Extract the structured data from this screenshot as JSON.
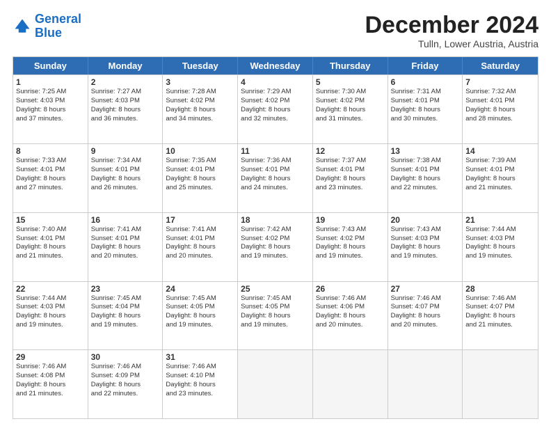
{
  "logo": {
    "line1": "General",
    "line2": "Blue"
  },
  "title": "December 2024",
  "subtitle": "Tulln, Lower Austria, Austria",
  "days_of_week": [
    "Sunday",
    "Monday",
    "Tuesday",
    "Wednesday",
    "Thursday",
    "Friday",
    "Saturday"
  ],
  "weeks": [
    [
      {
        "day": "1",
        "lines": [
          "Sunrise: 7:25 AM",
          "Sunset: 4:03 PM",
          "Daylight: 8 hours",
          "and 37 minutes."
        ]
      },
      {
        "day": "2",
        "lines": [
          "Sunrise: 7:27 AM",
          "Sunset: 4:03 PM",
          "Daylight: 8 hours",
          "and 36 minutes."
        ]
      },
      {
        "day": "3",
        "lines": [
          "Sunrise: 7:28 AM",
          "Sunset: 4:02 PM",
          "Daylight: 8 hours",
          "and 34 minutes."
        ]
      },
      {
        "day": "4",
        "lines": [
          "Sunrise: 7:29 AM",
          "Sunset: 4:02 PM",
          "Daylight: 8 hours",
          "and 32 minutes."
        ]
      },
      {
        "day": "5",
        "lines": [
          "Sunrise: 7:30 AM",
          "Sunset: 4:02 PM",
          "Daylight: 8 hours",
          "and 31 minutes."
        ]
      },
      {
        "day": "6",
        "lines": [
          "Sunrise: 7:31 AM",
          "Sunset: 4:01 PM",
          "Daylight: 8 hours",
          "and 30 minutes."
        ]
      },
      {
        "day": "7",
        "lines": [
          "Sunrise: 7:32 AM",
          "Sunset: 4:01 PM",
          "Daylight: 8 hours",
          "and 28 minutes."
        ]
      }
    ],
    [
      {
        "day": "8",
        "lines": [
          "Sunrise: 7:33 AM",
          "Sunset: 4:01 PM",
          "Daylight: 8 hours",
          "and 27 minutes."
        ]
      },
      {
        "day": "9",
        "lines": [
          "Sunrise: 7:34 AM",
          "Sunset: 4:01 PM",
          "Daylight: 8 hours",
          "and 26 minutes."
        ]
      },
      {
        "day": "10",
        "lines": [
          "Sunrise: 7:35 AM",
          "Sunset: 4:01 PM",
          "Daylight: 8 hours",
          "and 25 minutes."
        ]
      },
      {
        "day": "11",
        "lines": [
          "Sunrise: 7:36 AM",
          "Sunset: 4:01 PM",
          "Daylight: 8 hours",
          "and 24 minutes."
        ]
      },
      {
        "day": "12",
        "lines": [
          "Sunrise: 7:37 AM",
          "Sunset: 4:01 PM",
          "Daylight: 8 hours",
          "and 23 minutes."
        ]
      },
      {
        "day": "13",
        "lines": [
          "Sunrise: 7:38 AM",
          "Sunset: 4:01 PM",
          "Daylight: 8 hours",
          "and 22 minutes."
        ]
      },
      {
        "day": "14",
        "lines": [
          "Sunrise: 7:39 AM",
          "Sunset: 4:01 PM",
          "Daylight: 8 hours",
          "and 21 minutes."
        ]
      }
    ],
    [
      {
        "day": "15",
        "lines": [
          "Sunrise: 7:40 AM",
          "Sunset: 4:01 PM",
          "Daylight: 8 hours",
          "and 21 minutes."
        ]
      },
      {
        "day": "16",
        "lines": [
          "Sunrise: 7:41 AM",
          "Sunset: 4:01 PM",
          "Daylight: 8 hours",
          "and 20 minutes."
        ]
      },
      {
        "day": "17",
        "lines": [
          "Sunrise: 7:41 AM",
          "Sunset: 4:01 PM",
          "Daylight: 8 hours",
          "and 20 minutes."
        ]
      },
      {
        "day": "18",
        "lines": [
          "Sunrise: 7:42 AM",
          "Sunset: 4:02 PM",
          "Daylight: 8 hours",
          "and 19 minutes."
        ]
      },
      {
        "day": "19",
        "lines": [
          "Sunrise: 7:43 AM",
          "Sunset: 4:02 PM",
          "Daylight: 8 hours",
          "and 19 minutes."
        ]
      },
      {
        "day": "20",
        "lines": [
          "Sunrise: 7:43 AM",
          "Sunset: 4:03 PM",
          "Daylight: 8 hours",
          "and 19 minutes."
        ]
      },
      {
        "day": "21",
        "lines": [
          "Sunrise: 7:44 AM",
          "Sunset: 4:03 PM",
          "Daylight: 8 hours",
          "and 19 minutes."
        ]
      }
    ],
    [
      {
        "day": "22",
        "lines": [
          "Sunrise: 7:44 AM",
          "Sunset: 4:03 PM",
          "Daylight: 8 hours",
          "and 19 minutes."
        ]
      },
      {
        "day": "23",
        "lines": [
          "Sunrise: 7:45 AM",
          "Sunset: 4:04 PM",
          "Daylight: 8 hours",
          "and 19 minutes."
        ]
      },
      {
        "day": "24",
        "lines": [
          "Sunrise: 7:45 AM",
          "Sunset: 4:05 PM",
          "Daylight: 8 hours",
          "and 19 minutes."
        ]
      },
      {
        "day": "25",
        "lines": [
          "Sunrise: 7:45 AM",
          "Sunset: 4:05 PM",
          "Daylight: 8 hours",
          "and 19 minutes."
        ]
      },
      {
        "day": "26",
        "lines": [
          "Sunrise: 7:46 AM",
          "Sunset: 4:06 PM",
          "Daylight: 8 hours",
          "and 20 minutes."
        ]
      },
      {
        "day": "27",
        "lines": [
          "Sunrise: 7:46 AM",
          "Sunset: 4:07 PM",
          "Daylight: 8 hours",
          "and 20 minutes."
        ]
      },
      {
        "day": "28",
        "lines": [
          "Sunrise: 7:46 AM",
          "Sunset: 4:07 PM",
          "Daylight: 8 hours",
          "and 21 minutes."
        ]
      }
    ],
    [
      {
        "day": "29",
        "lines": [
          "Sunrise: 7:46 AM",
          "Sunset: 4:08 PM",
          "Daylight: 8 hours",
          "and 21 minutes."
        ]
      },
      {
        "day": "30",
        "lines": [
          "Sunrise: 7:46 AM",
          "Sunset: 4:09 PM",
          "Daylight: 8 hours",
          "and 22 minutes."
        ]
      },
      {
        "day": "31",
        "lines": [
          "Sunrise: 7:46 AM",
          "Sunset: 4:10 PM",
          "Daylight: 8 hours",
          "and 23 minutes."
        ]
      },
      {
        "day": "",
        "lines": []
      },
      {
        "day": "",
        "lines": []
      },
      {
        "day": "",
        "lines": []
      },
      {
        "day": "",
        "lines": []
      }
    ]
  ]
}
